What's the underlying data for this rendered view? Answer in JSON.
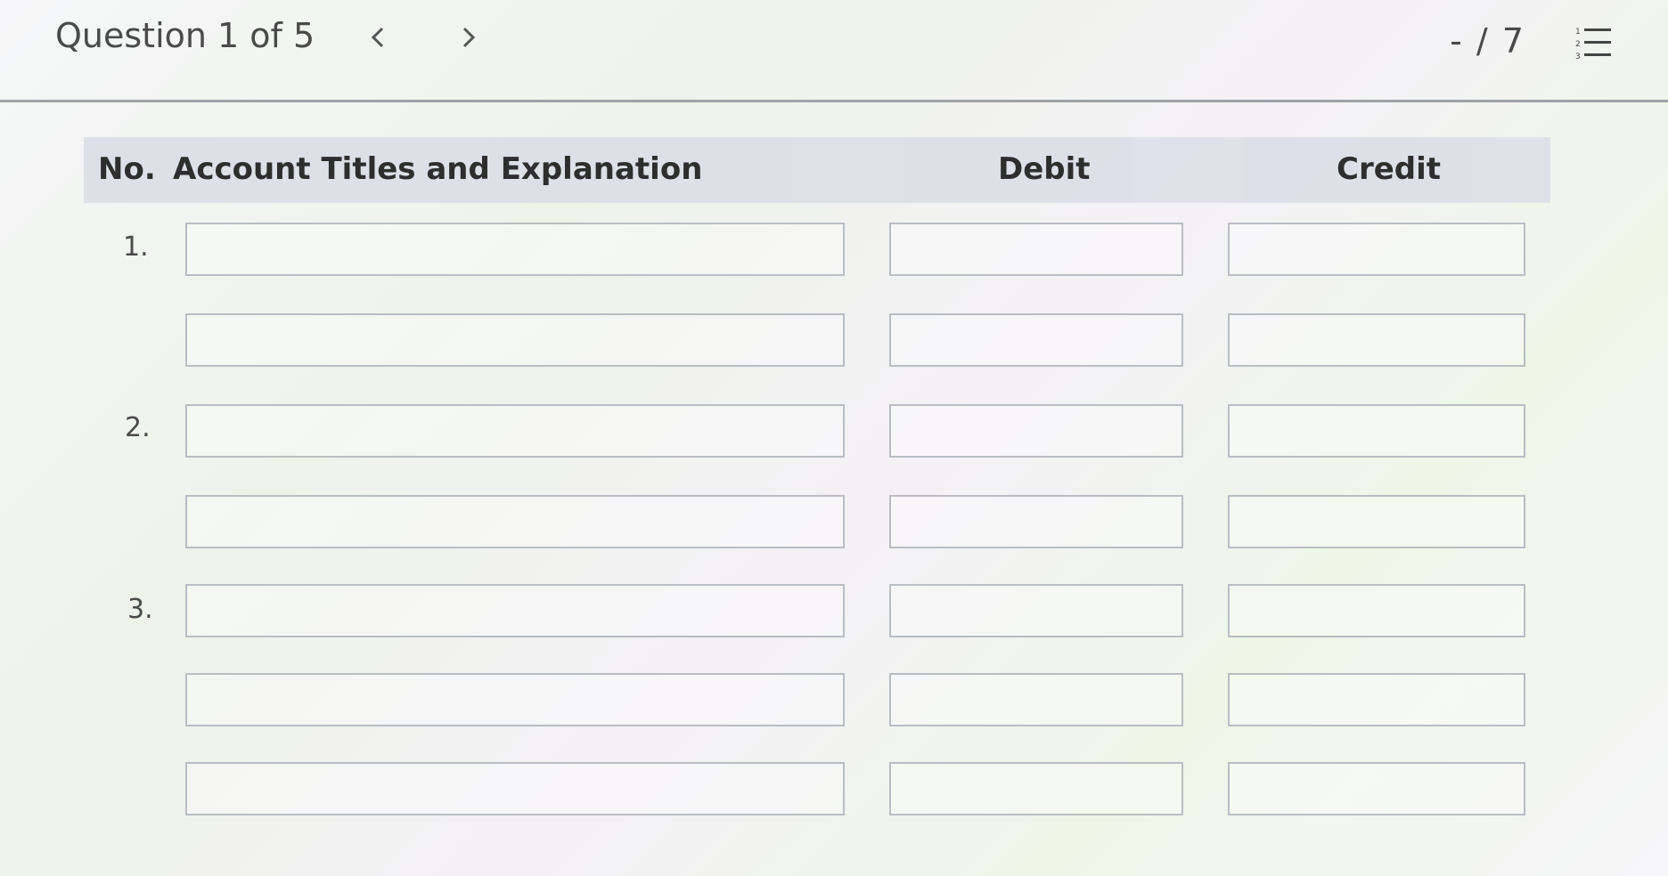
{
  "header": {
    "question_label": "Question 1 of 5",
    "score": "- / 7"
  },
  "icons": {
    "prev": "chevron-left-icon",
    "next": "chevron-right-icon",
    "list": "numbered-list-icon"
  },
  "table": {
    "columns": {
      "no": "No.",
      "account": "Account Titles and Explanation",
      "debit": "Debit",
      "credit": "Credit"
    },
    "entries": [
      {
        "number": "1.",
        "lines": [
          {
            "account": "",
            "debit": "",
            "credit": ""
          },
          {
            "account": "",
            "debit": "",
            "credit": ""
          }
        ]
      },
      {
        "number": "2.",
        "lines": [
          {
            "account": "",
            "debit": "",
            "credit": ""
          },
          {
            "account": "",
            "debit": "",
            "credit": ""
          }
        ]
      },
      {
        "number": "3.",
        "lines": [
          {
            "account": "",
            "debit": "",
            "credit": ""
          },
          {
            "account": "",
            "debit": "",
            "credit": ""
          },
          {
            "account": "",
            "debit": "",
            "credit": ""
          }
        ]
      }
    ]
  }
}
